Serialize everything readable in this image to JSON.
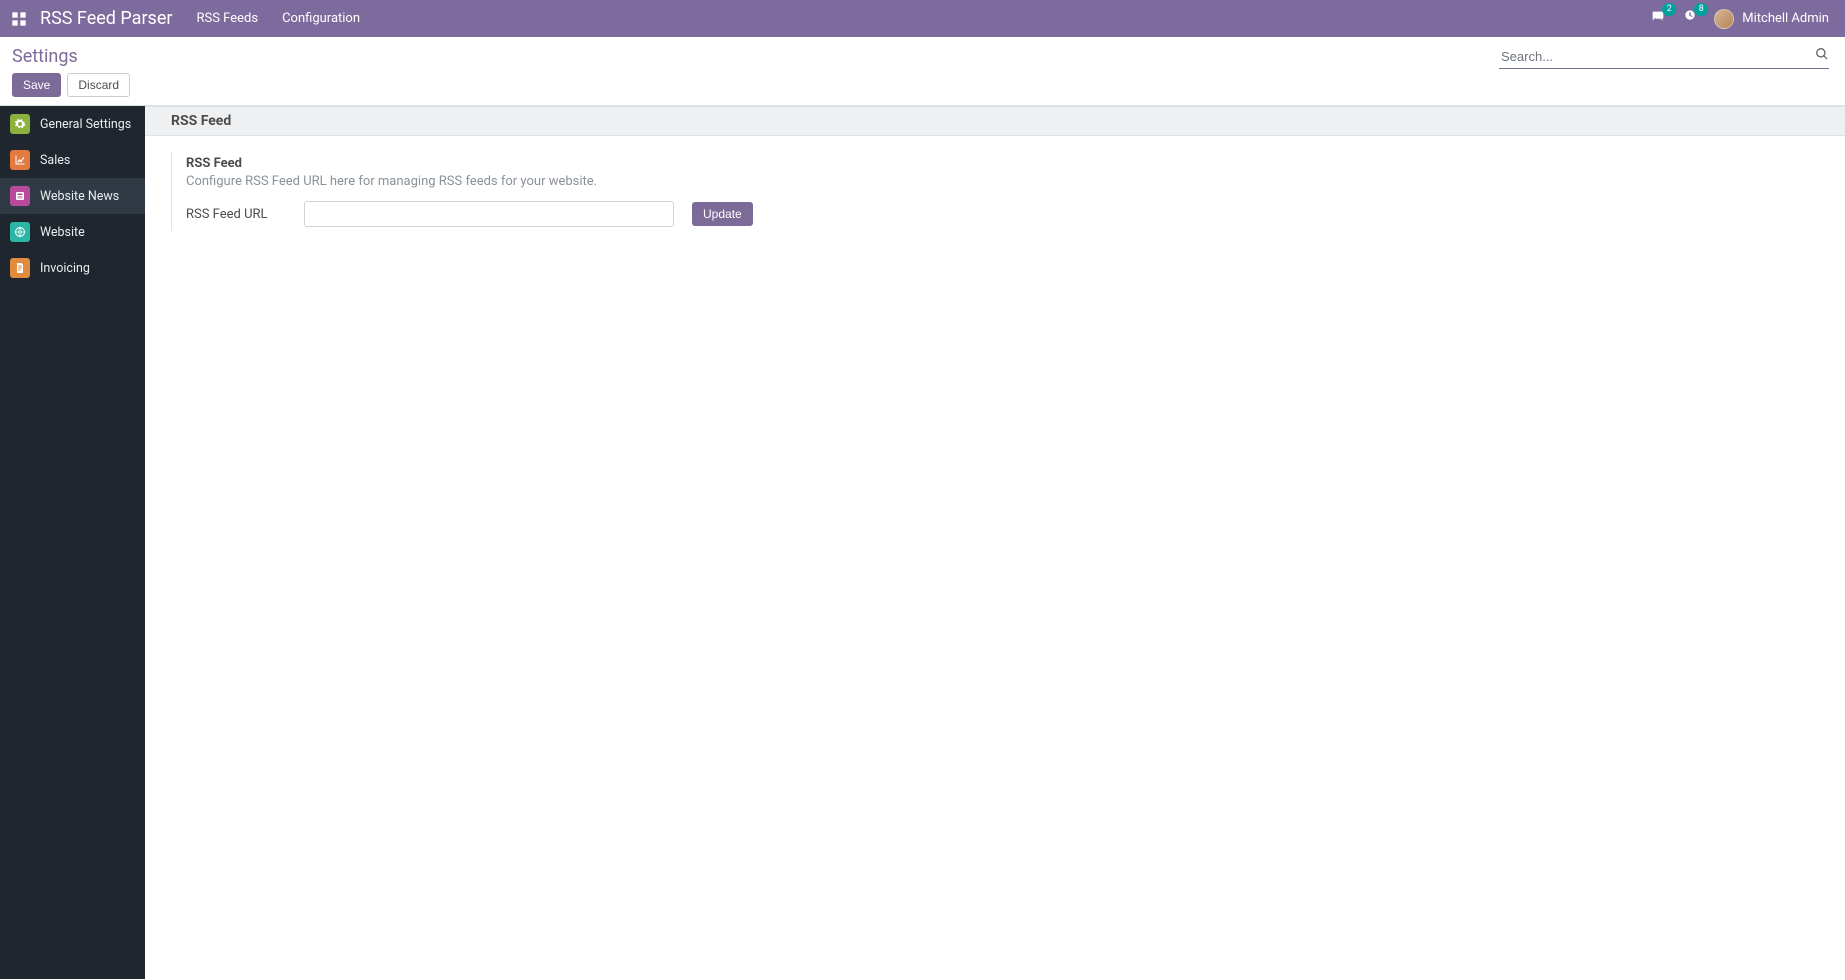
{
  "colors": {
    "primary": "#7c6a99",
    "badge": "#00a09d",
    "sidebarBg": "#1f262d"
  },
  "topnav": {
    "appTitle": "RSS Feed Parser",
    "links": [
      {
        "label": "RSS Feeds"
      },
      {
        "label": "Configuration"
      }
    ],
    "discussBadge": "2",
    "activityBadge": "8",
    "userName": "Mitchell Admin"
  },
  "controlPanel": {
    "breadcrumb": "Settings",
    "saveLabel": "Save",
    "discardLabel": "Discard",
    "searchPlaceholder": "Search..."
  },
  "sidebar": {
    "items": [
      {
        "label": "General Settings",
        "iconBg": "#8bb23d",
        "iconName": "gear-icon"
      },
      {
        "label": "Sales",
        "iconBg": "#e27a3f",
        "iconName": "chart-line-icon"
      },
      {
        "label": "Website News",
        "iconBg": "#b84a9d",
        "iconName": "news-square-icon",
        "selected": true
      },
      {
        "label": "Website",
        "iconBg": "#2bb5a6",
        "iconName": "globe-icon"
      },
      {
        "label": "Invoicing",
        "iconBg": "#e08b3e",
        "iconName": "invoice-icon"
      }
    ]
  },
  "main": {
    "sectionHeader": "RSS Feed",
    "boxTitle": "RSS Feed",
    "boxDesc": "Configure RSS Feed URL here for managing RSS feeds for your website.",
    "urlLabel": "RSS Feed URL",
    "urlValue": "",
    "updateLabel": "Update"
  }
}
